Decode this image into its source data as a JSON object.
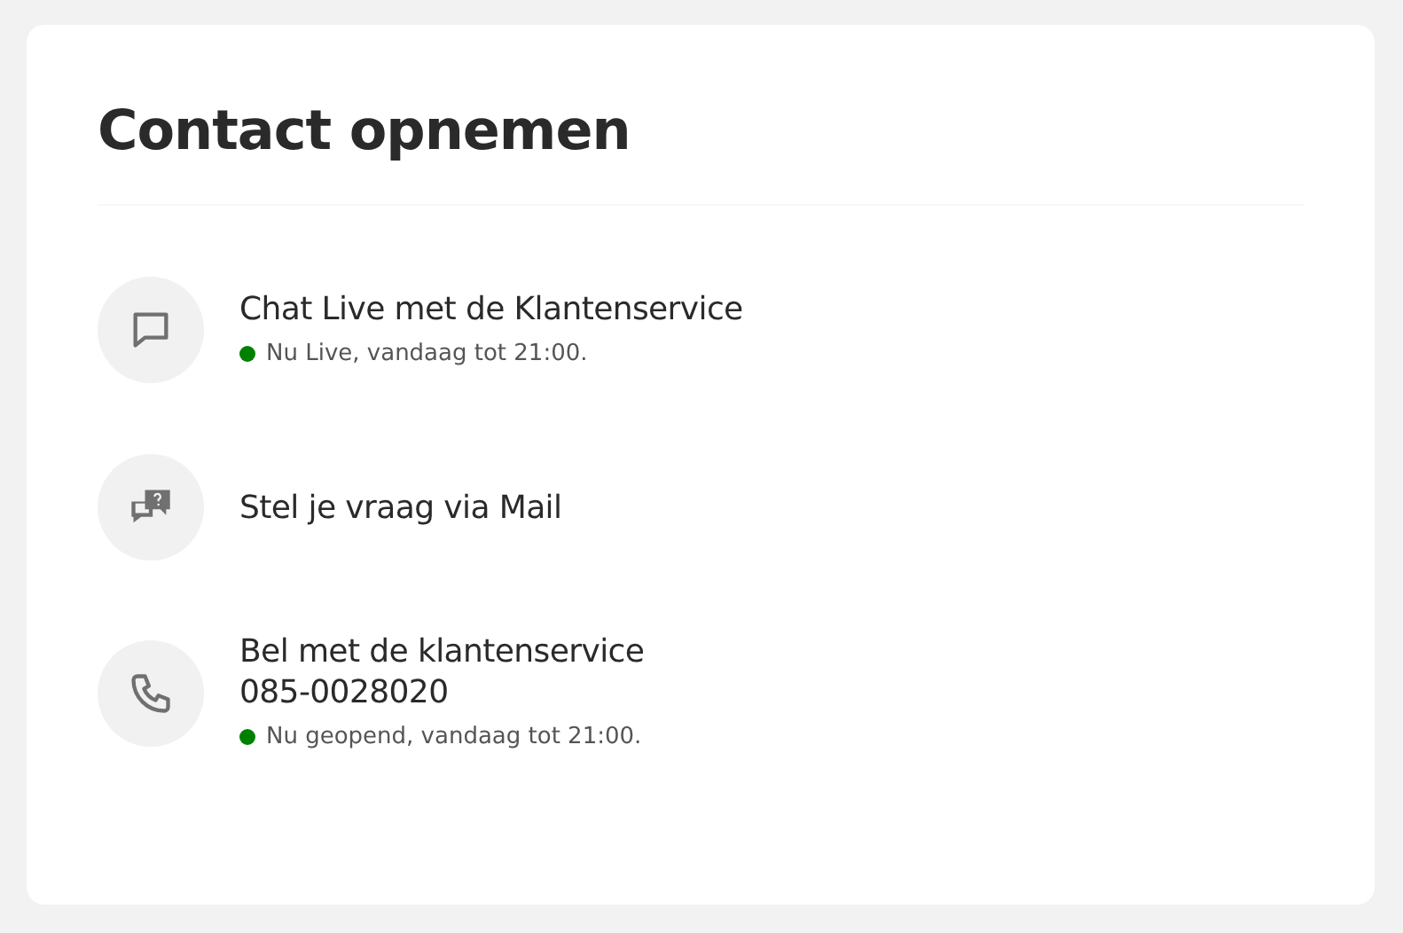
{
  "title": "Contact opnemen",
  "options": [
    {
      "kind": "chat",
      "title": "Chat Live met de Klantenservice",
      "status": {
        "text": "Nu Live, vandaag tot 21:00.",
        "color": "#008000"
      }
    },
    {
      "kind": "mail",
      "title": "Stel je vraag via Mail"
    },
    {
      "kind": "phone",
      "title": "Bel met de klantenservice",
      "number": "085-0028020",
      "status": {
        "text": "Nu geopend, vandaag tot 21:00.",
        "color": "#008000"
      }
    }
  ]
}
